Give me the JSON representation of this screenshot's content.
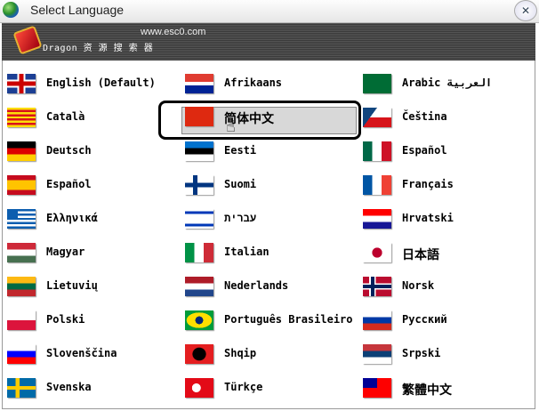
{
  "window": {
    "title": "Select Language",
    "close_icon": "close-icon"
  },
  "banner": {
    "url": "www.esc0.com",
    "brand": "Dragon 资 源 搜 索 器"
  },
  "selected": "简体中文",
  "languages": [
    [
      {
        "label": "English (Default)",
        "flag": "gb"
      },
      {
        "label": "Afrikaans",
        "flag": "za"
      },
      {
        "label": "Arabic العربية",
        "flag": "sa"
      }
    ],
    [
      {
        "label": "Català",
        "flag": "ca"
      },
      {
        "label": "简体中文",
        "flag": "cn"
      },
      {
        "label": "Čeština",
        "flag": "cz"
      }
    ],
    [
      {
        "label": "Deutsch",
        "flag": "de"
      },
      {
        "label": "Eesti",
        "flag": "ee"
      },
      {
        "label": "Español",
        "flag": "mx"
      }
    ],
    [
      {
        "label": "Español",
        "flag": "es"
      },
      {
        "label": "Suomi",
        "flag": "fi"
      },
      {
        "label": "Français",
        "flag": "fr"
      }
    ],
    [
      {
        "label": "Ελληνικά",
        "flag": "gr"
      },
      {
        "label": "עברית",
        "flag": "il"
      },
      {
        "label": "Hrvatski",
        "flag": "hr"
      }
    ],
    [
      {
        "label": "Magyar",
        "flag": "hu"
      },
      {
        "label": "Italian",
        "flag": "it"
      },
      {
        "label": "日本語",
        "flag": "jp"
      }
    ],
    [
      {
        "label": "Lietuvių",
        "flag": "lt"
      },
      {
        "label": "Nederlands",
        "flag": "nl"
      },
      {
        "label": "Norsk",
        "flag": "no"
      }
    ],
    [
      {
        "label": "Polski",
        "flag": "pl"
      },
      {
        "label": "Português Brasileiro",
        "flag": "br"
      },
      {
        "label": "Русский",
        "flag": "ru"
      }
    ],
    [
      {
        "label": "Slovenščina",
        "flag": "si"
      },
      {
        "label": "Shqip",
        "flag": "al"
      },
      {
        "label": "Srpski",
        "flag": "rs"
      }
    ],
    [
      {
        "label": "Svenska",
        "flag": "se"
      },
      {
        "label": "Türkçe",
        "flag": "tr"
      },
      {
        "label": "繁體中文",
        "flag": "tw"
      }
    ]
  ]
}
